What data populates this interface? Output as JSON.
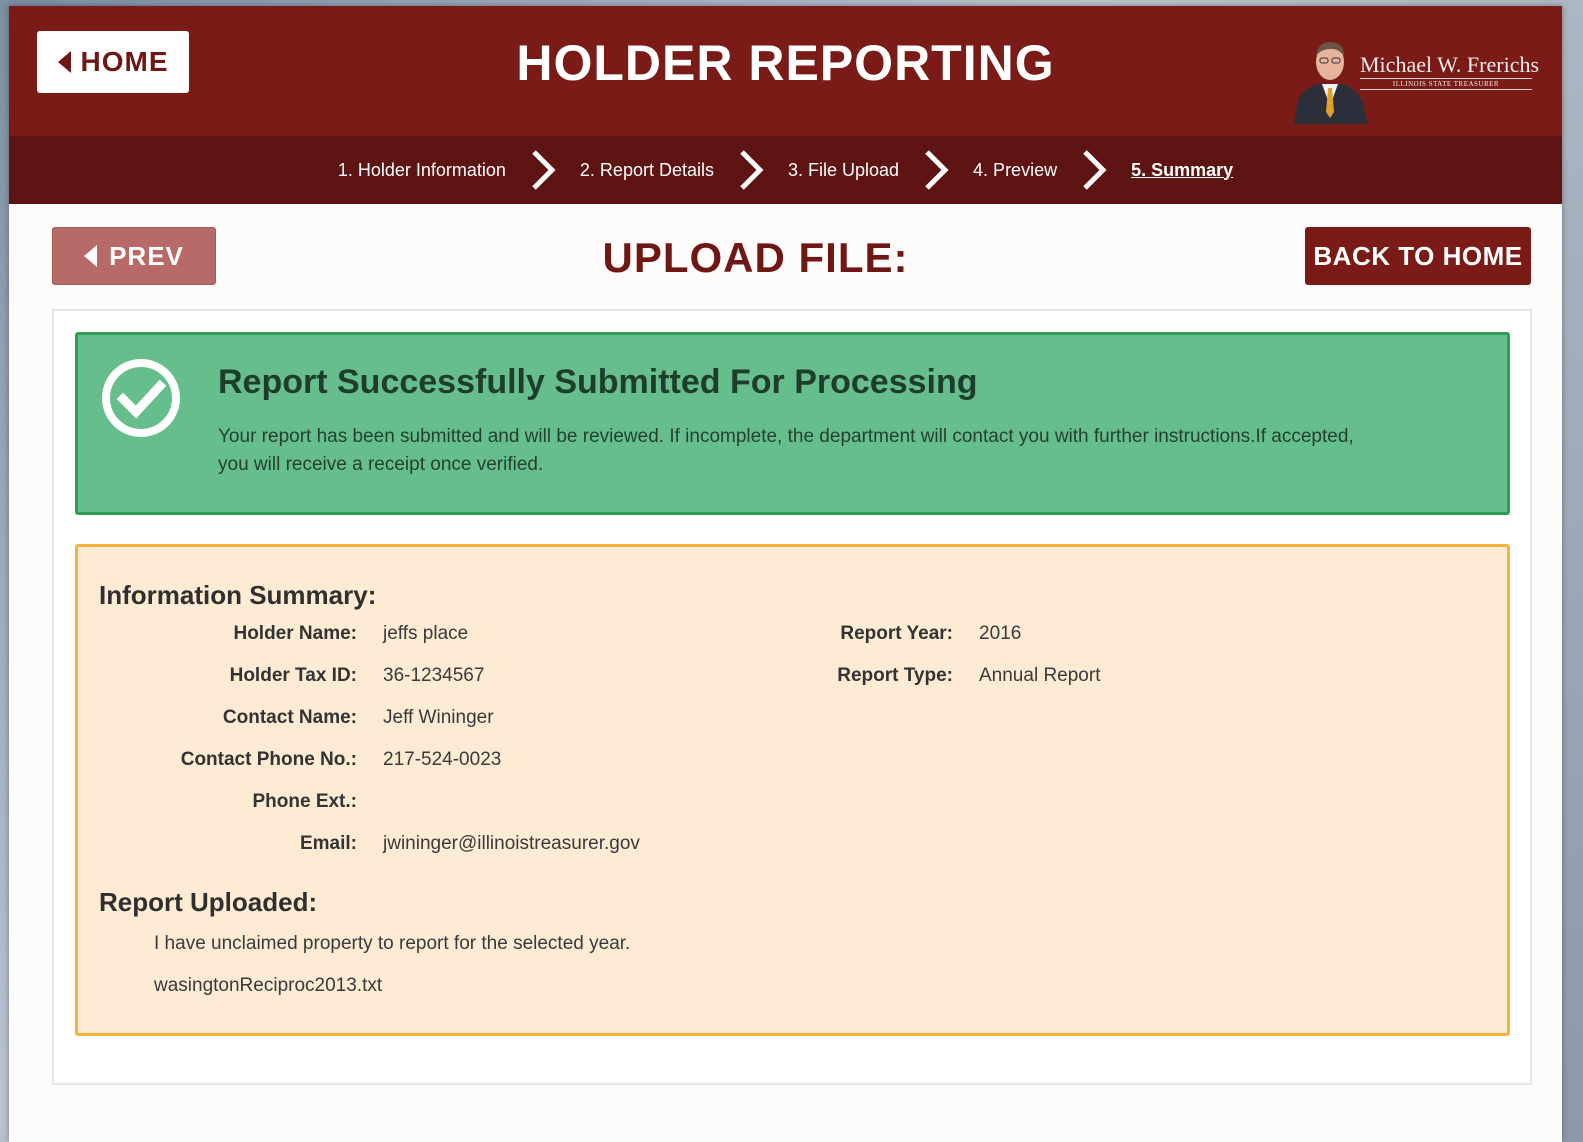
{
  "header": {
    "home_label": "HOME",
    "title": "HOLDER REPORTING",
    "treasurer_name": "Michael W. Frerichs",
    "treasurer_subtitle": "ILLINOIS STATE TREASURER"
  },
  "steps": [
    {
      "label": "1. Holder Information",
      "active": false
    },
    {
      "label": "2. Report Details",
      "active": false
    },
    {
      "label": "3. File Upload",
      "active": false
    },
    {
      "label": "4. Preview",
      "active": false
    },
    {
      "label": "5. Summary",
      "active": true
    }
  ],
  "toolbar": {
    "prev_label": "PREV",
    "heading": "UPLOAD FILE:",
    "back_home_label": "BACK TO HOME"
  },
  "success": {
    "title": "Report Successfully Submitted For Processing",
    "message": "Your report has been submitted and will be reviewed. If incomplete, the department will contact you with further instructions.If accepted, you will receive a receipt once verified."
  },
  "summary": {
    "title": "Information Summary:",
    "left_fields": [
      {
        "label": "Holder Name:",
        "value": "jeffs place"
      },
      {
        "label": "Holder Tax ID:",
        "value": "36-1234567"
      },
      {
        "label": "Contact Name:",
        "value": "Jeff Wininger"
      },
      {
        "label": "Contact Phone No.:",
        "value": "217-524-0023"
      },
      {
        "label": "Phone Ext.:",
        "value": ""
      },
      {
        "label": "Email:",
        "value": "jwininger@illinoistreasurer.gov"
      }
    ],
    "right_fields": [
      {
        "label": "Report Year:",
        "value": "2016"
      },
      {
        "label": "Report Type:",
        "value": "Annual Report"
      }
    ],
    "uploaded_title": "Report Uploaded:",
    "uploaded_statement": "I have unclaimed property to report for the selected year.",
    "uploaded_file": "wasingtonReciproc2013.txt"
  },
  "colors": {
    "brand_dark_red": "#7a1b18",
    "steps_bar": "#5e1412",
    "success_green": "#66be8c",
    "summary_bg": "#fdebd3",
    "summary_border": "#f5b240"
  },
  "icons": {
    "home": "caret-left-icon",
    "prev": "caret-left-icon",
    "step_separator": "chevron-right-icon",
    "success": "check-circle-icon"
  }
}
